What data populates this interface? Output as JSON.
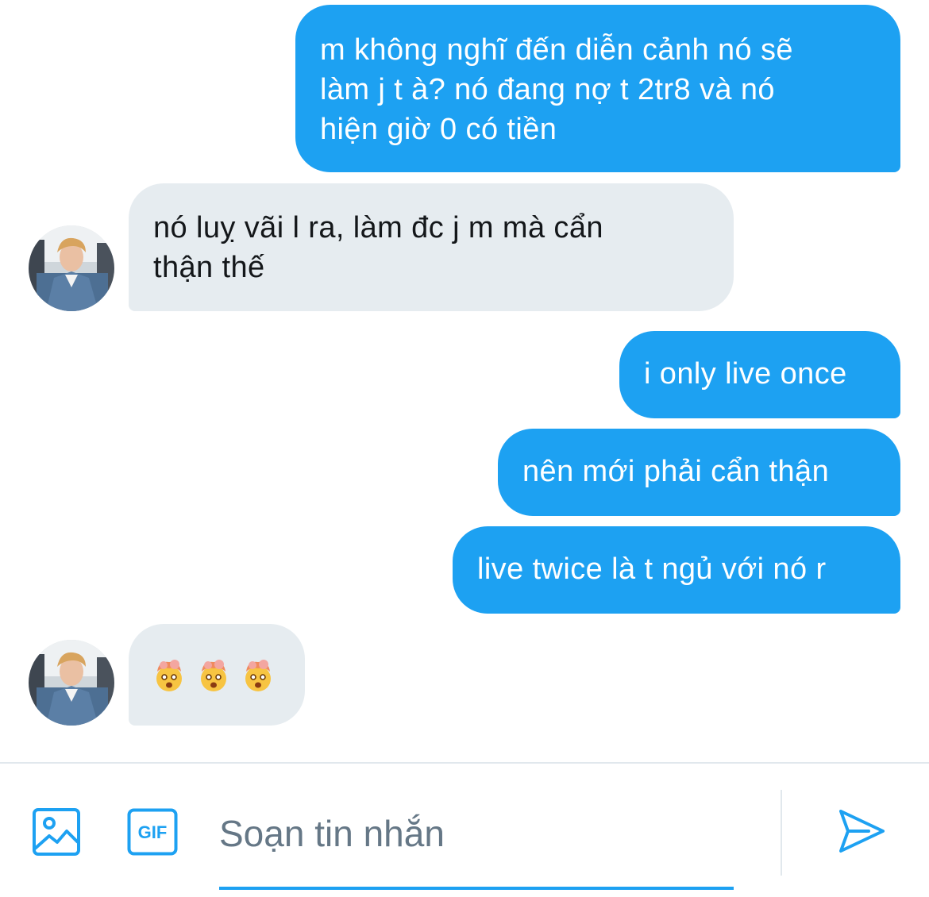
{
  "messages": [
    {
      "direction": "out",
      "lines": [
        "m không nghĩ đến diễn cảnh nó sẽ",
        "làm j t à? nó đang nợ t 2tr8 và nó",
        "hiện giờ 0 có tiền"
      ]
    },
    {
      "direction": "in",
      "lines": [
        "nó luỵ vãi l ra, làm đc j m mà cẩn",
        "thận thế"
      ]
    },
    {
      "direction": "out",
      "lines": [
        "i only live once"
      ]
    },
    {
      "direction": "out",
      "lines": [
        "nên mới phải cẩn thận"
      ]
    },
    {
      "direction": "out",
      "lines": [
        "live twice là t ngủ với nó r"
      ]
    },
    {
      "direction": "in",
      "emoji": [
        "exploding-head",
        "exploding-head",
        "exploding-head"
      ]
    }
  ],
  "composer": {
    "placeholder": "Soạn tin nhắn",
    "value": "",
    "gif_label": "GIF",
    "icons": {
      "media": "image-icon",
      "gif": "gif-icon",
      "send": "send-icon"
    }
  },
  "colors": {
    "outgoing_bubble": "#1da1f2",
    "incoming_bubble": "#e6ecf0",
    "accent": "#1da1f2"
  }
}
